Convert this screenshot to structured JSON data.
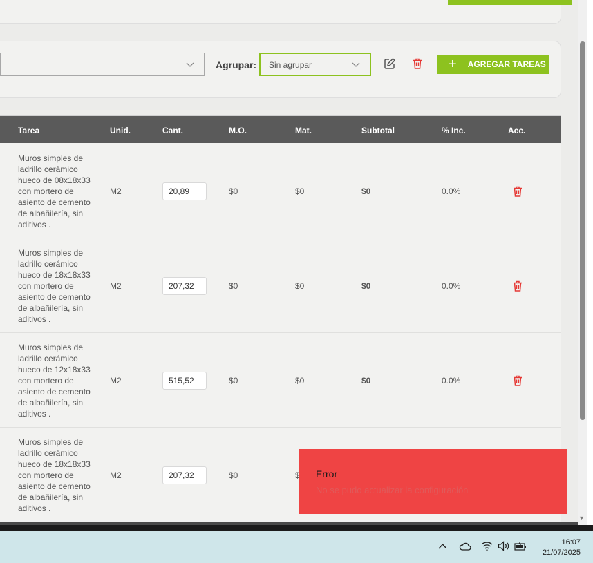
{
  "toolbar": {
    "group_label": "Agrupar:",
    "group_value": "Sin agrupar",
    "add_tasks_label": "AGREGAR TAREAS"
  },
  "table": {
    "columns": [
      "Tarea",
      "Unid.",
      "Cant.",
      "M.O.",
      "Mat.",
      "Subtotal",
      "% Inc.",
      "Acc."
    ],
    "rows": [
      {
        "tarea": "Muros simples de ladrillo cerámico hueco de 08x18x33 con mortero de asiento de cemento de albañilería, sin aditivos .",
        "unid": "M2",
        "cant": "20,89",
        "mo": "$0",
        "mat": "$0",
        "subtotal": "$0",
        "inc": "0.0%"
      },
      {
        "tarea": "Muros simples de ladrillo cerámico hueco de 18x18x33 con mortero de asiento de cemento de albañilería, sin aditivos .",
        "unid": "M2",
        "cant": "207,32",
        "mo": "$0",
        "mat": "$0",
        "subtotal": "$0",
        "inc": "0.0%"
      },
      {
        "tarea": "Muros simples de ladrillo cerámico hueco de 12x18x33 con mortero de asiento de cemento de albañilería, sin aditivos .",
        "unid": "M2",
        "cant": "515,52",
        "mo": "$0",
        "mat": "$0",
        "subtotal": "$0",
        "inc": "0.0%"
      },
      {
        "tarea": "Muros simples de ladrillo cerámico hueco de 18x18x33 con mortero de asiento de cemento de albañilería, sin aditivos .",
        "unid": "M2",
        "cant": "207,32",
        "mo": "$0",
        "mat": "$",
        "subtotal": "",
        "inc": ""
      }
    ]
  },
  "toast": {
    "title": "Error",
    "message": "No se pudo actualizar la configuración"
  },
  "taskbar": {
    "time": "16:07",
    "date": "21/07/2025"
  },
  "icons": [
    "chevron-down-icon",
    "edit-icon",
    "trash-icon",
    "plus-icon",
    "chevron-up-icon",
    "cloud-icon",
    "wifi-icon",
    "volume-icon",
    "battery-icon"
  ],
  "colors": {
    "accent": "#8dc21f",
    "danger": "#e53935",
    "toast": "#ef4444",
    "header": "#5a5a5a"
  }
}
